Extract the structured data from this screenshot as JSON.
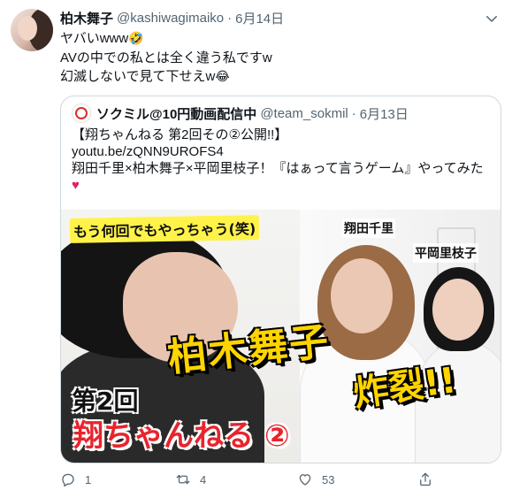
{
  "tweet": {
    "author_name": "柏木舞子",
    "author_handle": "@kashiwagimaiko",
    "separator": "·",
    "date": "6月14日",
    "lines": [
      "ヤバいwww",
      "AVの中での私とは全く違う私ですw",
      "幻滅しないで見て下せえw"
    ],
    "emoji1": "🤣",
    "emoji2": "😂",
    "more_icon": "chevron-down-icon"
  },
  "quoted": {
    "author_name": "ソクミル@10円動画配信中",
    "author_handle": "@team_sokmil",
    "separator": "·",
    "date": "6月13日",
    "lines": [
      "【翔ちゃんねる 第2回その②公開!!】",
      "youtu.be/zQNN9UROFS4",
      " 翔田千里×柏木舞子×平岡里枝子！『はぁって言うゲーム』やってみた"
    ],
    "heart": "♥",
    "thumbnail": {
      "caption_top": "もう何回でもやっちゃう(笑)",
      "name1": "翔田千里",
      "name2": "平岡里枝子",
      "big": "柏木舞子",
      "blast": "炸裂!!",
      "round": "第2回",
      "show": "翔ちゃんねる ②"
    }
  },
  "actions": {
    "reply_count": "1",
    "retweet_count": "4",
    "like_count": "53"
  },
  "colors": {
    "text": "#0f1419",
    "muted": "#536471",
    "border": "#cfd9de",
    "heart": "#e0245e"
  }
}
